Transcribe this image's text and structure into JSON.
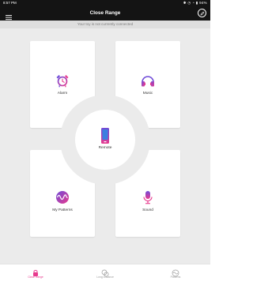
{
  "status_bar": {
    "time": "8:57 PM",
    "icons": [
      "bluetooth-icon",
      "alarm-icon",
      "wifi-icon"
    ],
    "battery": "94%"
  },
  "app_bar": {
    "title": "Close Range",
    "left_icon": "hamburger-menu-icon",
    "right_icon": "pencil-edit-icon"
  },
  "connection_banner": {
    "text": "Your toy is not currently connected"
  },
  "cards": {
    "alarm": {
      "label": "Alarm",
      "icon": "alarm-clock-icon"
    },
    "music": {
      "label": "Music",
      "icon": "headphones-icon"
    },
    "patterns": {
      "label": "My Patterns",
      "icon": "waveform-icon"
    },
    "sound": {
      "label": "Sound",
      "icon": "microphone-icon"
    },
    "remote": {
      "label": "Remote",
      "icon": "phone-remote-icon"
    }
  },
  "tabs": [
    {
      "label": "Close Range",
      "icon": "toy-icon",
      "active": true
    },
    {
      "label": "Long Distance",
      "icon": "chat-bubbles-icon",
      "active": false
    },
    {
      "label": "Patterns",
      "icon": "patterns-icon",
      "active": false
    }
  ],
  "colors": {
    "header_bg": "#141414",
    "banner_bg": "#dedede",
    "content_bg": "#ebebeb",
    "accent_pink": "#e83a8e",
    "accent_purple": "#6f4bd8",
    "accent_blue": "#3a7fe0"
  }
}
